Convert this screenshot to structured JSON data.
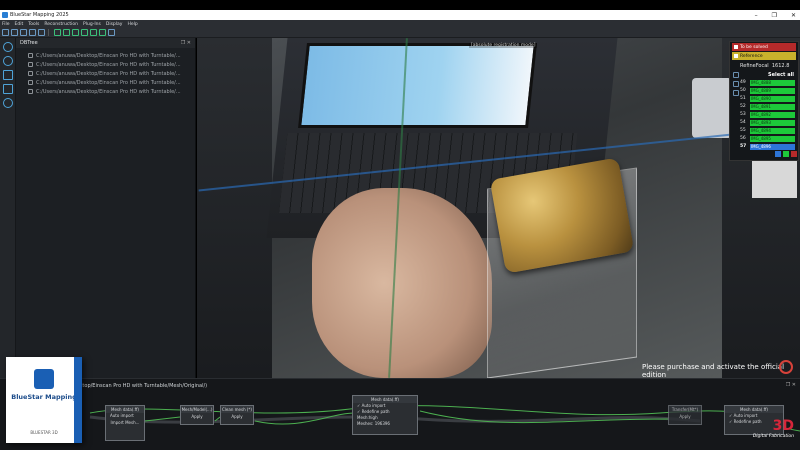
{
  "window": {
    "title": "BlueStar Mapping 2025",
    "min": "–",
    "restore": "❐",
    "close": "✕"
  },
  "menu": [
    "File",
    "Edit",
    "Tools",
    "Reconstruction",
    "Plug-Ins",
    "Display",
    "Help"
  ],
  "tree": {
    "title": "DBTree",
    "rows": [
      "C:/Users/anuwa/Desktop/Einscan Pro HD with Turntable/...",
      "C:/Users/anuwa/Desktop/Einscan Pro HD with Turntable/...",
      "C:/Users/anuwa/Desktop/Einscan Pro HD with Turntable/...",
      "C:/Users/anuwa/Desktop/Einscan Pro HD with Turntable/...",
      "C:/Users/anuwa/Desktop/Einscan Pro HD with Turntable/..."
    ]
  },
  "viewport": {
    "mode_label": "[absolute registration mode]",
    "watermark": "Please purchase and activate the official edition"
  },
  "image_panel": {
    "to_be_solved": "To be solved",
    "reference": "Reference",
    "refine_focal_label": "RefineFocal",
    "refine_focal_value": "1612.8",
    "select_all": "Select all",
    "items": [
      {
        "num": "49",
        "name": "IMG_4888"
      },
      {
        "num": "50",
        "name": "IMG_4889"
      },
      {
        "num": "51",
        "name": "IMG_4890"
      },
      {
        "num": "52",
        "name": "IMG_4891"
      },
      {
        "num": "53",
        "name": "IMG_4892"
      },
      {
        "num": "54",
        "name": "IMG_4893"
      },
      {
        "num": "55",
        "name": "IMG_4894"
      },
      {
        "num": "56",
        "name": "IMG_4895"
      },
      {
        "num": "57",
        "name": "IMG_4896"
      }
    ],
    "colors": {
      "red": "#b52a2a",
      "yellow": "#c9b12c",
      "green": "#1dc83a",
      "blue": "#2d75d8"
    }
  },
  "bottom": {
    "path": "Desktop/Einscan Pro HD with Turntable/Mesh/Original/)",
    "nodes": {
      "n1": {
        "head": "Mesh data(.ff)",
        "opt": "Auto import",
        "btn": "Import Mesh..."
      },
      "n2": {
        "head": "Mesh/Model(...)",
        "btn": "Apply"
      },
      "n3": {
        "head": "Clean mesh (*)",
        "btn": "Apply"
      },
      "n4": {
        "head": "Mesh data(.ff)",
        "opt1": "Auto import",
        "opt2": "Redefine path",
        "line1": "Mesh:high",
        "line2": "Meshes: 196396"
      },
      "n5": {
        "head": "Transfer(Mt*)",
        "btn": "Apply"
      },
      "n6": {
        "head": "Mesh data(.ff)",
        "opt1": "Auto import",
        "opt2": "Redefine path"
      }
    }
  },
  "promo": {
    "title": "BlueStar Mapping",
    "footer": "BLUESTAR 3D"
  },
  "brand": {
    "name": "3D",
    "sub": "Digital Fabrication"
  }
}
